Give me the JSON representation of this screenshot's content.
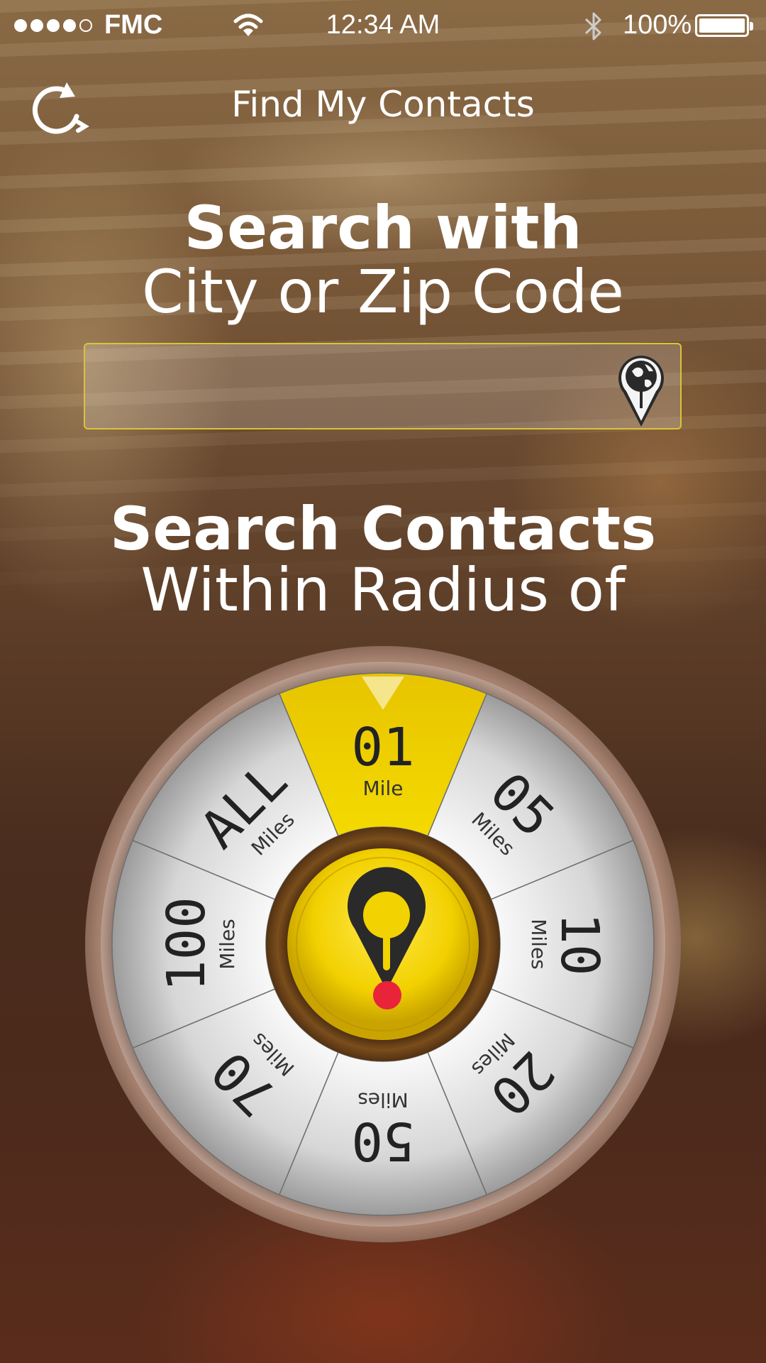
{
  "status_bar": {
    "carrier": "FMC",
    "signal_bars_filled": 4,
    "signal_bars_total": 5,
    "time": "12:34 AM",
    "battery_percent": "100%"
  },
  "nav": {
    "title": "Find My Contacts",
    "refresh_icon": "refresh-icon"
  },
  "search_location": {
    "heading_bold": "Search with",
    "heading_light": "City or Zip Code",
    "input_value": "",
    "input_placeholder": "",
    "icon": "globe-pin-icon"
  },
  "radius": {
    "heading_bold": "Search Contacts",
    "heading_light": "Within Radius of",
    "selected_index": 0,
    "options": [
      {
        "value": "01",
        "unit": "Mile"
      },
      {
        "value": "05",
        "unit": "Miles"
      },
      {
        "value": "10",
        "unit": "Miles"
      },
      {
        "value": "20",
        "unit": "Miles"
      },
      {
        "value": "50",
        "unit": "Miles"
      },
      {
        "value": "70",
        "unit": "Miles"
      },
      {
        "value": "100",
        "unit": "Miles"
      },
      {
        "value": "ALL",
        "unit": "Miles"
      }
    ],
    "center_icon": "location-pin-icon"
  },
  "colors": {
    "accent_yellow": "#f2d400",
    "pin_red": "#e8233a",
    "dark_pin": "#2a2a2a"
  }
}
